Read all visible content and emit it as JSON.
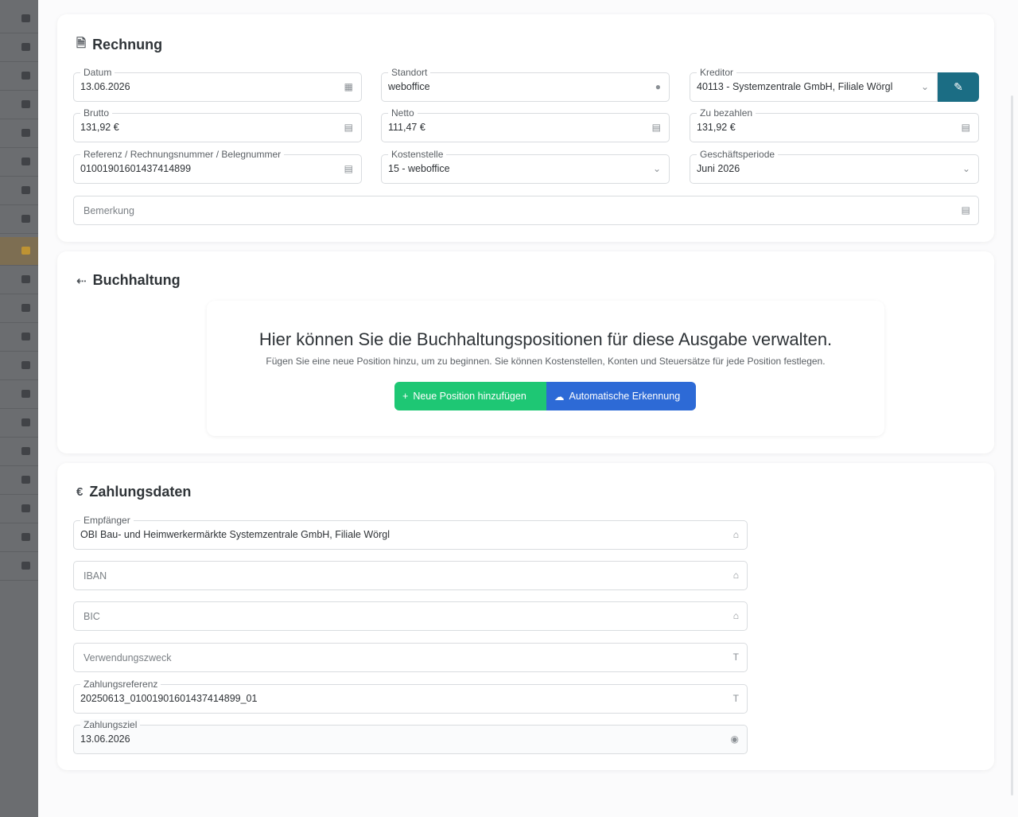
{
  "rechnung": {
    "title": "Rechnung",
    "title_icon": "document-icon",
    "datum": {
      "label": "Datum",
      "value": "13.06.2026",
      "icon": "calendar-icon"
    },
    "standort": {
      "label": "Standort",
      "value": "weboffice",
      "icon": "pin-icon"
    },
    "kreditor": {
      "label": "Kreditor",
      "value": "40113 - Systemzentrale GmbH, Filiale Wörgl",
      "icon": "chevron-down-icon"
    },
    "edit_icon": "pencil-icon",
    "brutto": {
      "label": "Brutto",
      "value": "131,92 €",
      "icon": "money-icon"
    },
    "netto": {
      "label": "Netto",
      "value": "111,47 €",
      "icon": "money-icon"
    },
    "zu_bezahlen": {
      "label": "Zu bezahlen",
      "value": "131,92 €",
      "icon": "money-icon"
    },
    "referenz": {
      "label": "Referenz / Rechnungsnummer / Belegnummer",
      "value": "01001901601437414899",
      "icon": "money-icon"
    },
    "kostenstelle": {
      "label": "Kostenstelle",
      "value": "15 - weboffice",
      "icon": "chevron-down-icon"
    },
    "periode": {
      "label": "Geschäftsperiode",
      "value": "Juni 2026",
      "icon": "chevron-down-icon"
    },
    "bemerkung": {
      "placeholder": "Bemerkung",
      "icon": "comment-icon"
    }
  },
  "buchhaltung": {
    "title": "Buchhaltung",
    "title_icon": "arrows-left-right-icon",
    "heading": "Hier können Sie die Buchhaltungspositionen für diese Ausgabe verwalten.",
    "subtext": "Fügen Sie eine neue Position hinzu, um zu beginnen. Sie können Kostenstellen, Konten und Steuersätze für jede Position festlegen.",
    "add_button": "Neue Position hinzufügen",
    "auto_button": "Automatische Erkennung",
    "colors": {
      "green": "#1ec774",
      "blue": "#2d6ad6"
    }
  },
  "zahlungsdaten": {
    "title": "Zahlungsdaten",
    "title_icon": "euro-icon",
    "empfaenger": {
      "label": "Empfänger",
      "value": "OBI Bau- und Heimwerkermärkte Systemzentrale GmbH, Filiale Wörgl",
      "icon": "bank-icon"
    },
    "iban": {
      "placeholder": "IBAN",
      "icon": "bank-icon"
    },
    "bic": {
      "placeholder": "BIC",
      "icon": "bank-icon"
    },
    "verwendungszweck": {
      "placeholder": "Verwendungszweck",
      "icon": "text-icon"
    },
    "zahlungsreferenz": {
      "label": "Zahlungsreferenz",
      "value": "20250613_01001901601437414899_01",
      "icon": "text-icon"
    },
    "zahlungsziel": {
      "label": "Zahlungsziel",
      "value": "13.06.2026",
      "icon": "clock-icon"
    }
  },
  "accent": "#1b6d84"
}
